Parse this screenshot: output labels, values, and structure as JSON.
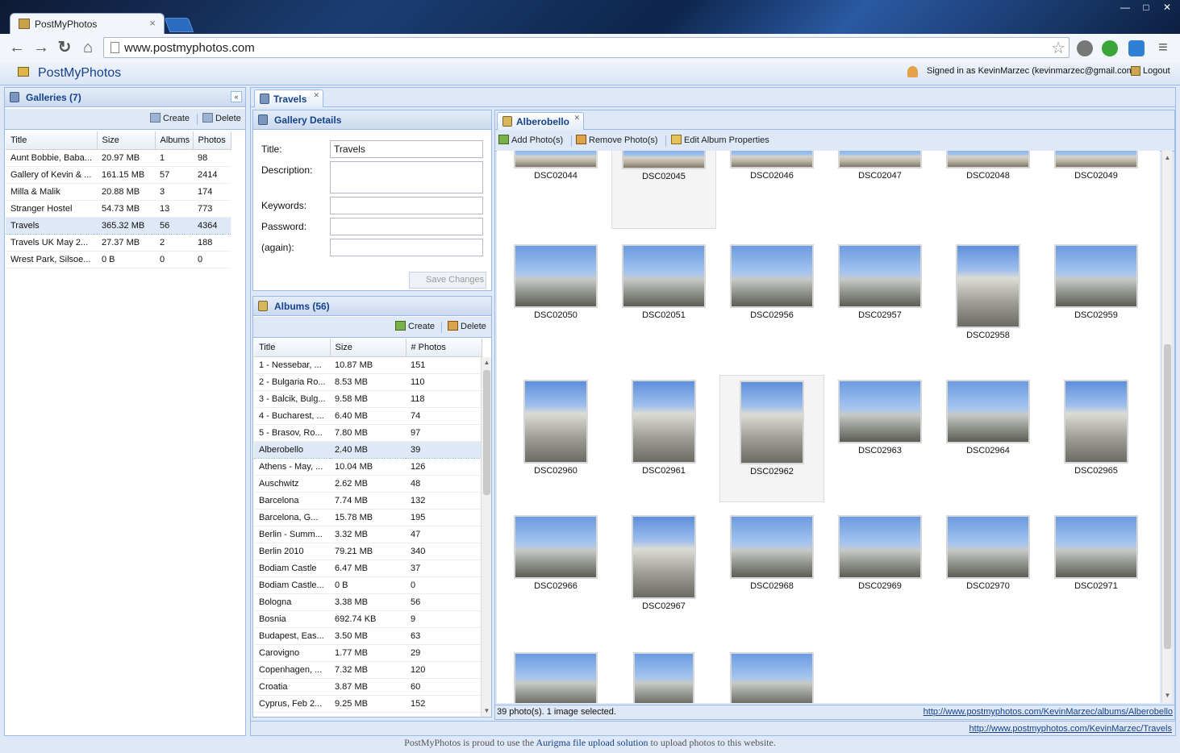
{
  "browser": {
    "tab_title": "PostMyPhotos",
    "tab_close": "×",
    "url": "www.postmyphotos.com",
    "window_controls": [
      "—",
      "□",
      "✕"
    ]
  },
  "app": {
    "title": "PostMyPhotos",
    "signed_in": "Signed in as KevinMarzec (kevinmarzec@gmail.com)",
    "logout": "Logout"
  },
  "galleries": {
    "title": "Galleries (7)",
    "create": "Create",
    "delete": "Delete",
    "columns": [
      "Title",
      "Size",
      "Albums",
      "Photos"
    ],
    "rows": [
      [
        "Aunt Bobbie, Baba...",
        "20.97 MB",
        "1",
        "98"
      ],
      [
        "Gallery of Kevin & ...",
        "161.15 MB",
        "57",
        "2414"
      ],
      [
        "Milla & Malik",
        "20.88 MB",
        "3",
        "174"
      ],
      [
        "Stranger Hostel",
        "54.73 MB",
        "13",
        "773"
      ],
      [
        "Travels",
        "365.32 MB",
        "56",
        "4364"
      ],
      [
        "Travels UK May 2...",
        "27.37 MB",
        "2",
        "188"
      ],
      [
        "Wrest Park, Silsoe...",
        "0 B",
        "0",
        "0"
      ]
    ],
    "selected_index": 4
  },
  "travels_tab": {
    "label": "Travels",
    "close": "✕"
  },
  "gallery_details": {
    "title": "Gallery Details",
    "title_label": "Title:",
    "title_value": "Travels",
    "description_label": "Description:",
    "keywords_label": "Keywords:",
    "password_label": "Password:",
    "again_label": "(again):",
    "save": "Save Changes"
  },
  "albums": {
    "title": "Albums (56)",
    "create": "Create",
    "delete": "Delete",
    "columns": [
      "Title",
      "Size",
      "# Photos"
    ],
    "rows": [
      [
        "1 - Nessebar, ...",
        "10.87 MB",
        "151"
      ],
      [
        "2 - Bulgaria Ro...",
        "8.53 MB",
        "110"
      ],
      [
        "3 - Balcik, Bulg...",
        "9.58 MB",
        "118"
      ],
      [
        "4 - Bucharest, ...",
        "6.40 MB",
        "74"
      ],
      [
        "5 - Brasov, Ro...",
        "7.80 MB",
        "97"
      ],
      [
        "Alberobello",
        "2.40 MB",
        "39"
      ],
      [
        "Athens - May, ...",
        "10.04 MB",
        "126"
      ],
      [
        "Auschwitz",
        "2.62 MB",
        "48"
      ],
      [
        "Barcelona",
        "7.74 MB",
        "132"
      ],
      [
        "Barcelona, G...",
        "15.78 MB",
        "195"
      ],
      [
        "Berlin - Summ...",
        "3.32 MB",
        "47"
      ],
      [
        "Berlin 2010",
        "79.21 MB",
        "340"
      ],
      [
        "Bodiam Castle",
        "6.47 MB",
        "37"
      ],
      [
        "Bodiam Castle...",
        "0 B",
        "0"
      ],
      [
        "Bologna",
        "3.38 MB",
        "56"
      ],
      [
        "Bosnia",
        "692.74 KB",
        "9"
      ],
      [
        "Budapest, Eas...",
        "3.50 MB",
        "63"
      ],
      [
        "Carovigno",
        "1.77 MB",
        "29"
      ],
      [
        "Copenhagen, ...",
        "7.32 MB",
        "120"
      ],
      [
        "Croatia",
        "3.87 MB",
        "60"
      ],
      [
        "Cyprus, Feb 2...",
        "9.25 MB",
        "152"
      ]
    ],
    "selected_index": 5
  },
  "album_tab": {
    "label": "Alberobello",
    "close": "✕",
    "add_photos": "Add Photo(s)",
    "remove_photos": "Remove Photo(s)",
    "edit_album": "Edit Album Properties",
    "status": "39 photo(s). 1 image selected.",
    "album_link": "http://www.postmyphotos.com/KevinMarzec/albums/Alberobello"
  },
  "photos": [
    [
      "DSC02044",
      "DSC02045",
      "DSC02046",
      "DSC02047",
      "DSC02048",
      "DSC02049"
    ],
    [
      "DSC02050",
      "DSC02051",
      "DSC02956",
      "DSC02957",
      "DSC02958",
      "DSC02959"
    ],
    [
      "DSC02960",
      "DSC02961",
      "DSC02962",
      "DSC02963",
      "DSC02964",
      "DSC02965"
    ],
    [
      "DSC02966",
      "DSC02967",
      "DSC02968",
      "DSC02969",
      "DSC02970",
      "DSC02971"
    ],
    [
      "",
      "",
      ""
    ]
  ],
  "gallery_link": "http://www.postmyphotos.com/KevinMarzec/Travels",
  "footer": {
    "before": "PostMyPhotos is proud to use the ",
    "link": "Aurigma file upload solution",
    "after": " to upload photos to this website."
  }
}
